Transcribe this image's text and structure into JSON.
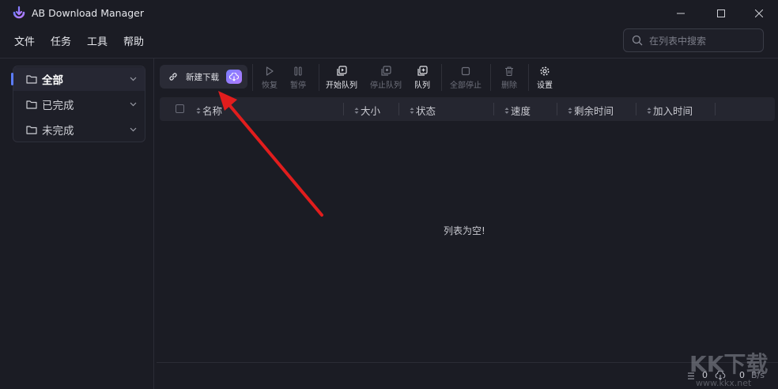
{
  "app": {
    "title": "AB Download Manager"
  },
  "menu": [
    {
      "label": "文件"
    },
    {
      "label": "任务"
    },
    {
      "label": "工具"
    },
    {
      "label": "帮助"
    }
  ],
  "search": {
    "placeholder": "在列表中搜索",
    "value": ""
  },
  "sidebar": {
    "items": [
      {
        "label": "全部",
        "active": true
      },
      {
        "label": "已完成",
        "active": false
      },
      {
        "label": "未完成",
        "active": false
      }
    ]
  },
  "toolbar": {
    "new_download": "新建下载",
    "resume": "恢复",
    "pause": "暂停",
    "start_queue": "开始队列",
    "stop_queue": "停止队列",
    "queue": "队列",
    "stop_all": "全部停止",
    "delete": "删除",
    "settings": "设置"
  },
  "table": {
    "columns": [
      {
        "label": "名称"
      },
      {
        "label": "大小"
      },
      {
        "label": "状态"
      },
      {
        "label": "速度"
      },
      {
        "label": "剩余时间"
      },
      {
        "label": "加入时间"
      }
    ],
    "empty_message": "列表为空!"
  },
  "status": {
    "total_count": "0",
    "active_count": "0",
    "speed": "B/s"
  },
  "watermark": {
    "text": "KK下载",
    "url": "www.kkx.net"
  },
  "colors": {
    "accent": "#5b7cfa",
    "annotation": "#e11d1d",
    "background": "#1b1c24"
  }
}
